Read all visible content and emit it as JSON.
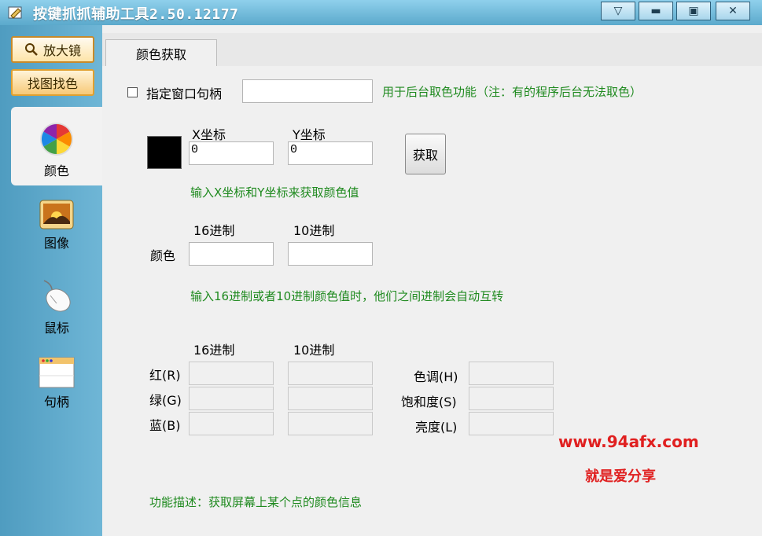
{
  "window": {
    "title": "按键抓抓辅助工具2.50.12177",
    "controls": [
      "minimize-to-tray",
      "minimize",
      "maximize",
      "close"
    ]
  },
  "sidebar": {
    "magnifier_label": "放大镜",
    "find_image_label": "找图找色",
    "items": [
      {
        "label": "颜色",
        "icon": "color-wheel-icon",
        "active": true
      },
      {
        "label": "图像",
        "icon": "image-icon",
        "active": false
      },
      {
        "label": "鼠标",
        "icon": "mouse-icon",
        "active": false
      },
      {
        "label": "句柄",
        "icon": "window-handle-icon",
        "active": false
      }
    ]
  },
  "tab": {
    "label": "颜色获取"
  },
  "handle": {
    "checkbox_label": "指定窗口句柄",
    "checked": false,
    "value": "",
    "hint": "用于后台取色功能（注：有的程序后台无法取色）"
  },
  "coords": {
    "swatch_color": "#000000",
    "x_label": "X坐标",
    "y_label": "Y坐标",
    "x_value": "0",
    "y_value": "0",
    "get_button": "获取",
    "hint": "输入X坐标和Y坐标来获取颜色值"
  },
  "color_value": {
    "hex_header": "16进制",
    "dec_header": "10进制",
    "row_label": "颜色",
    "hex_value": "",
    "dec_value": "",
    "hint": "输入16进制或者10进制颜色值时，他们之间进制会自动互转"
  },
  "components": {
    "hex_header": "16进制",
    "dec_header": "10进制",
    "rgb_labels": [
      "红(R)",
      "绿(G)",
      "蓝(B)"
    ],
    "hsl_labels": [
      "色调(H)",
      "饱和度(S)",
      "亮度(L)"
    ]
  },
  "watermark": {
    "line1": "www.94afx.com",
    "line2": "就是爱分享",
    "color": "#e02020"
  },
  "description": "功能描述：获取屏幕上某个点的颜色信息",
  "colors": {
    "hint_green": "#1f8a1f",
    "titlebar": "#6ab4d6"
  }
}
